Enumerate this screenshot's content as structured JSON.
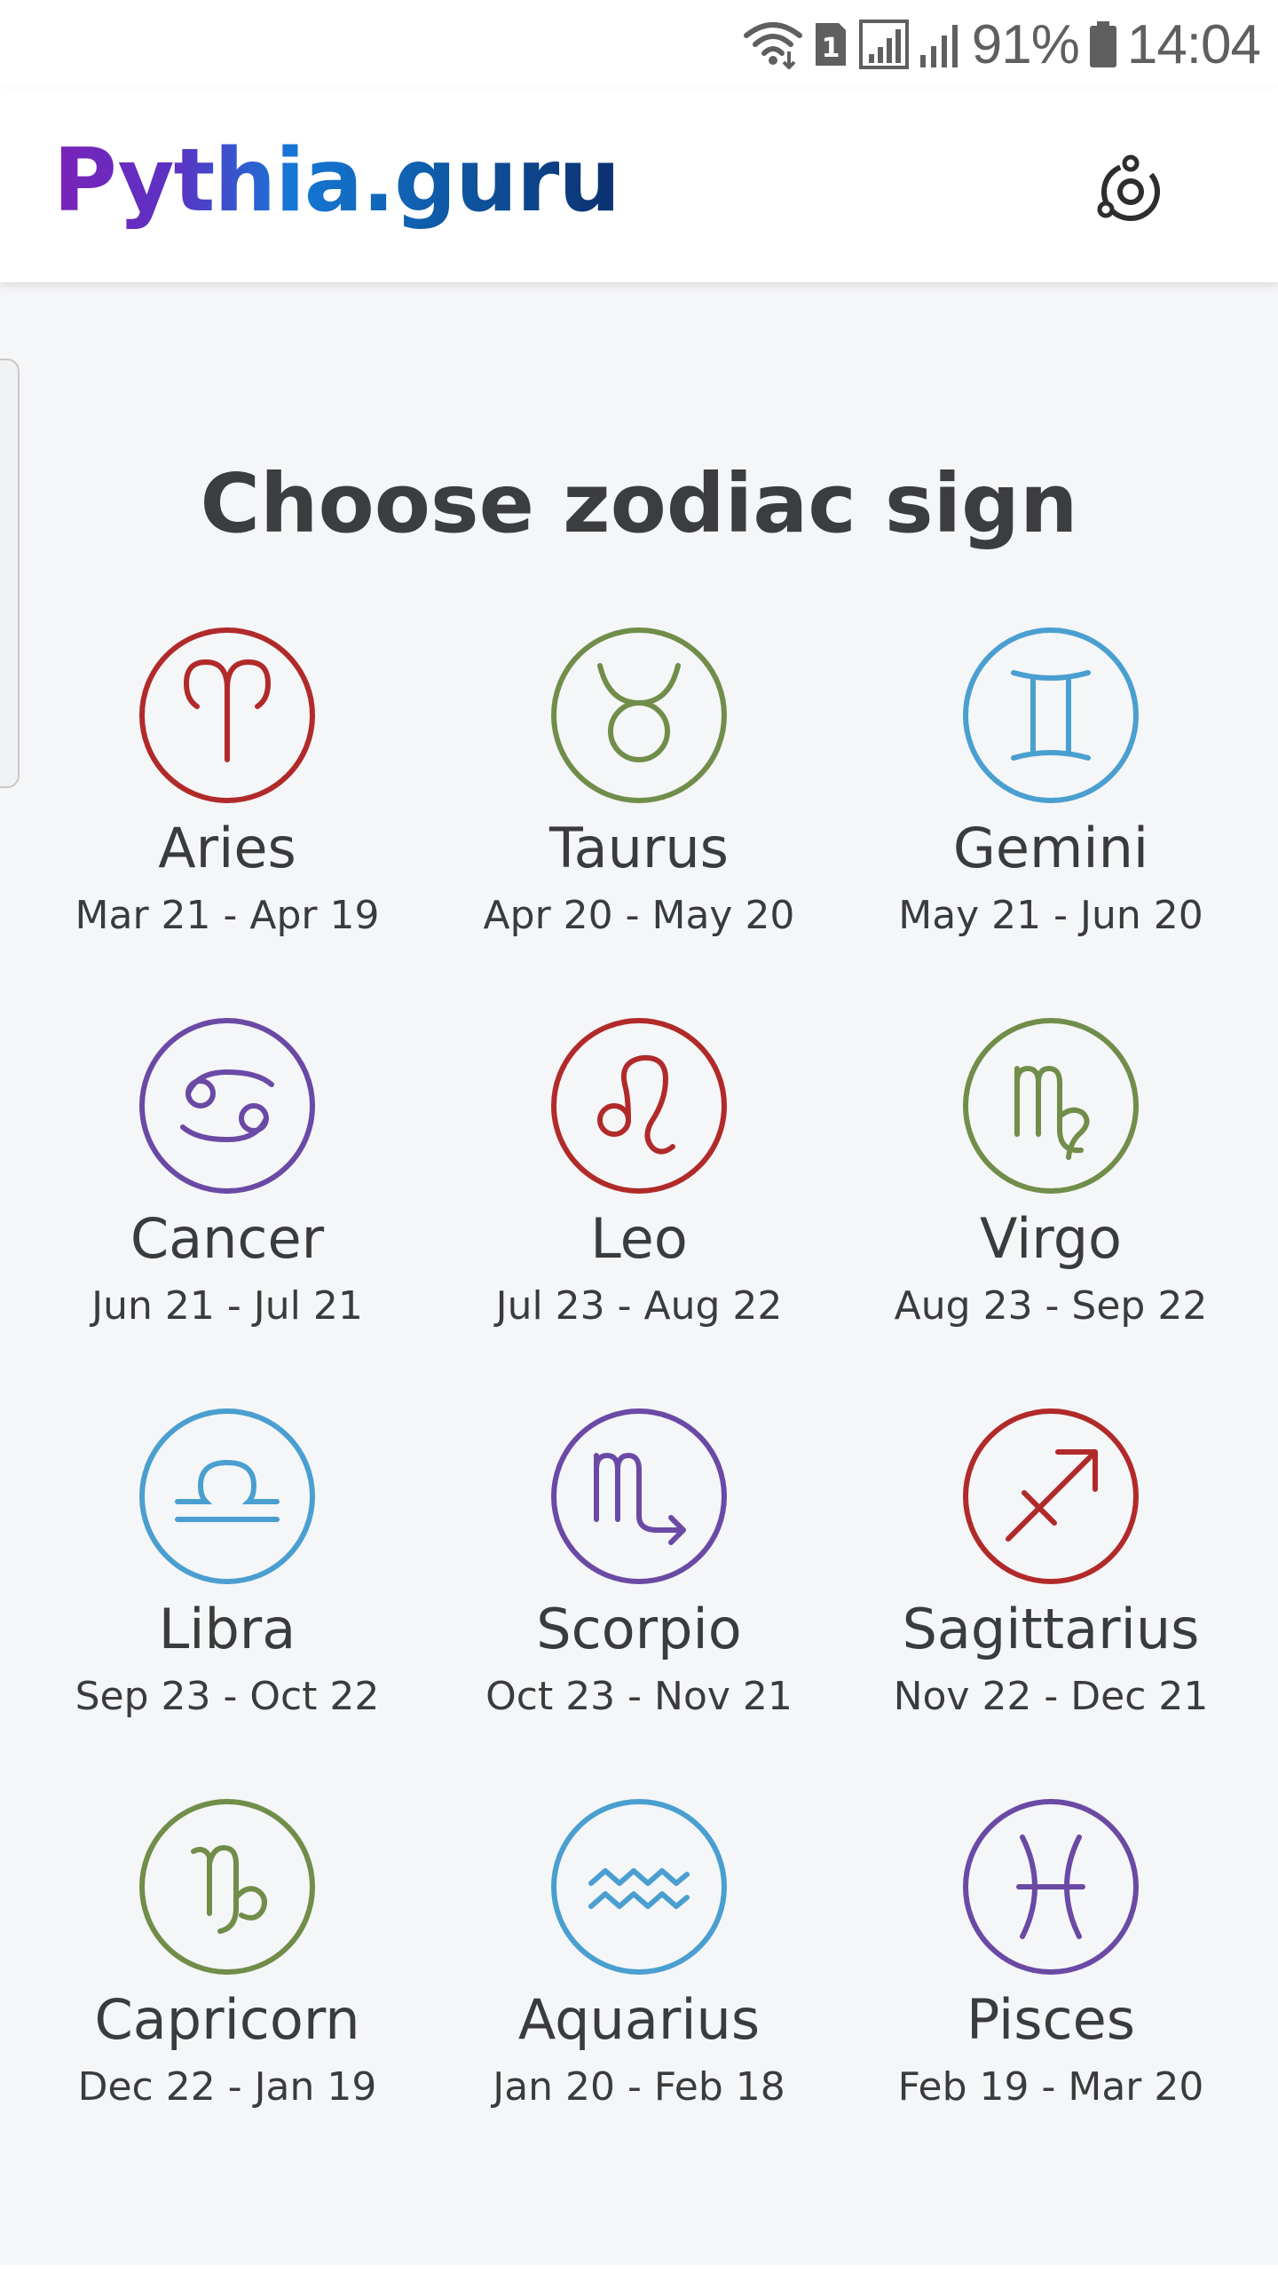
{
  "status_bar": {
    "sim_badge": "1",
    "battery": "91%",
    "time": "14:04",
    "icons": [
      "wifi-icon",
      "sim-1-icon",
      "signal-sim1-icon",
      "signal-sim2-icon",
      "battery-icon"
    ]
  },
  "header": {
    "logo": "Pythia.guru",
    "menu_icon": "orbit-icon"
  },
  "main": {
    "title": "Choose zodiac sign",
    "signs": [
      {
        "name": "Aries",
        "dates": "Mar 21 - Apr 19",
        "icon": "aries-icon",
        "color": "#b12a2a"
      },
      {
        "name": "Taurus",
        "dates": "Apr 20 - May 20",
        "icon": "taurus-icon",
        "color": "#718d4a"
      },
      {
        "name": "Gemini",
        "dates": "May 21 - Jun 20",
        "icon": "gemini-icon",
        "color": "#4a9fd0"
      },
      {
        "name": "Cancer",
        "dates": "Jun 21 - Jul 21",
        "icon": "cancer-icon",
        "color": "#6a4aa5"
      },
      {
        "name": "Leo",
        "dates": "Jul 23 - Aug 22",
        "icon": "leo-icon",
        "color": "#b12a2a"
      },
      {
        "name": "Virgo",
        "dates": "Aug 23 - Sep 22",
        "icon": "virgo-icon",
        "color": "#718d4a"
      },
      {
        "name": "Libra",
        "dates": "Sep 23 - Oct 22",
        "icon": "libra-icon",
        "color": "#4a9fd0"
      },
      {
        "name": "Scorpio",
        "dates": "Oct 23 - Nov 21",
        "icon": "scorpio-icon",
        "color": "#6a4aa5"
      },
      {
        "name": "Sagittarius",
        "dates": "Nov 22 - Dec 21",
        "icon": "sagittarius-icon",
        "color": "#b12a2a"
      },
      {
        "name": "Capricorn",
        "dates": "Dec 22 - Jan 19",
        "icon": "capricorn-icon",
        "color": "#718d4a"
      },
      {
        "name": "Aquarius",
        "dates": "Jan 20 - Feb 18",
        "icon": "aquarius-icon",
        "color": "#4a9fd0"
      },
      {
        "name": "Pisces",
        "dates": "Feb 19 - Mar 20",
        "icon": "pisces-icon",
        "color": "#6a4aa5"
      }
    ]
  }
}
